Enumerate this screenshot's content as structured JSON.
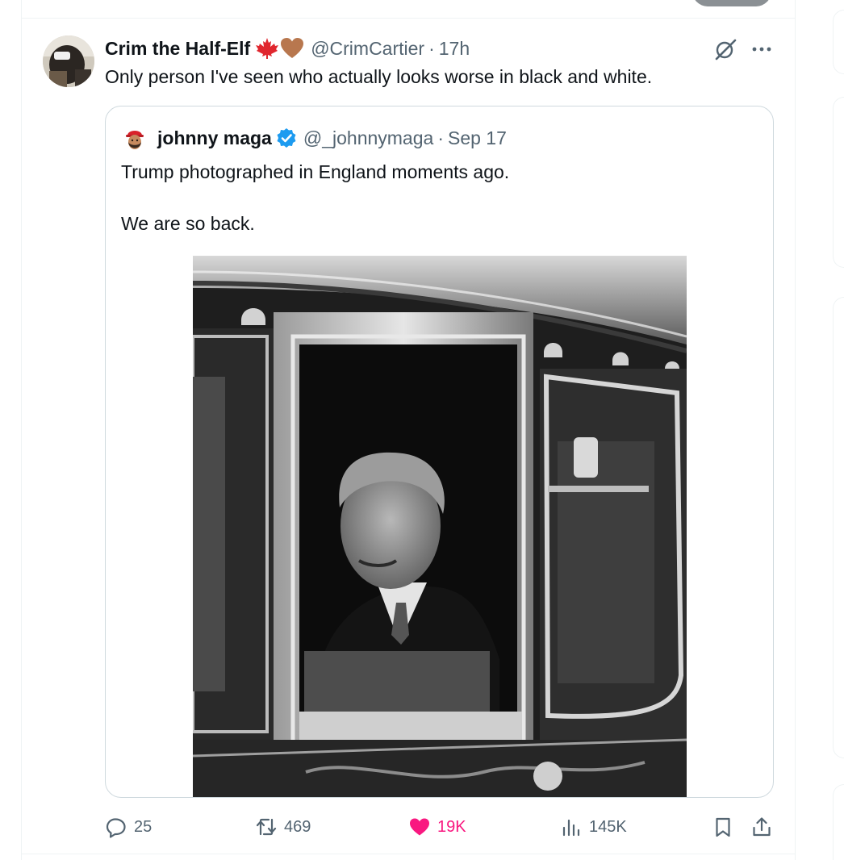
{
  "tweet": {
    "author_name": "Crim the Half-Elf",
    "author_handle": "@CrimCartier",
    "separator": "·",
    "time": "17h",
    "text": "Only person I've seen who actually looks worse in black and white.",
    "name_emojis": [
      "maple-leaf-icon",
      "brown-heart-icon"
    ]
  },
  "quote": {
    "author_name": "johnny maga",
    "author_handle": "@_johnnymaga",
    "separator": "·",
    "date": "Sep 17",
    "text_line1": "Trump photographed in England moments ago.",
    "text_line2": "We are so back.",
    "verified": true
  },
  "actions": {
    "replies": "25",
    "reposts": "469",
    "likes": "19K",
    "views": "145K",
    "liked": true
  },
  "colors": {
    "text_primary": "#0f1419",
    "text_secondary": "#536471",
    "like_pink": "#f91880",
    "verified_blue": "#1d9bf0",
    "border": "#cfd9de"
  }
}
